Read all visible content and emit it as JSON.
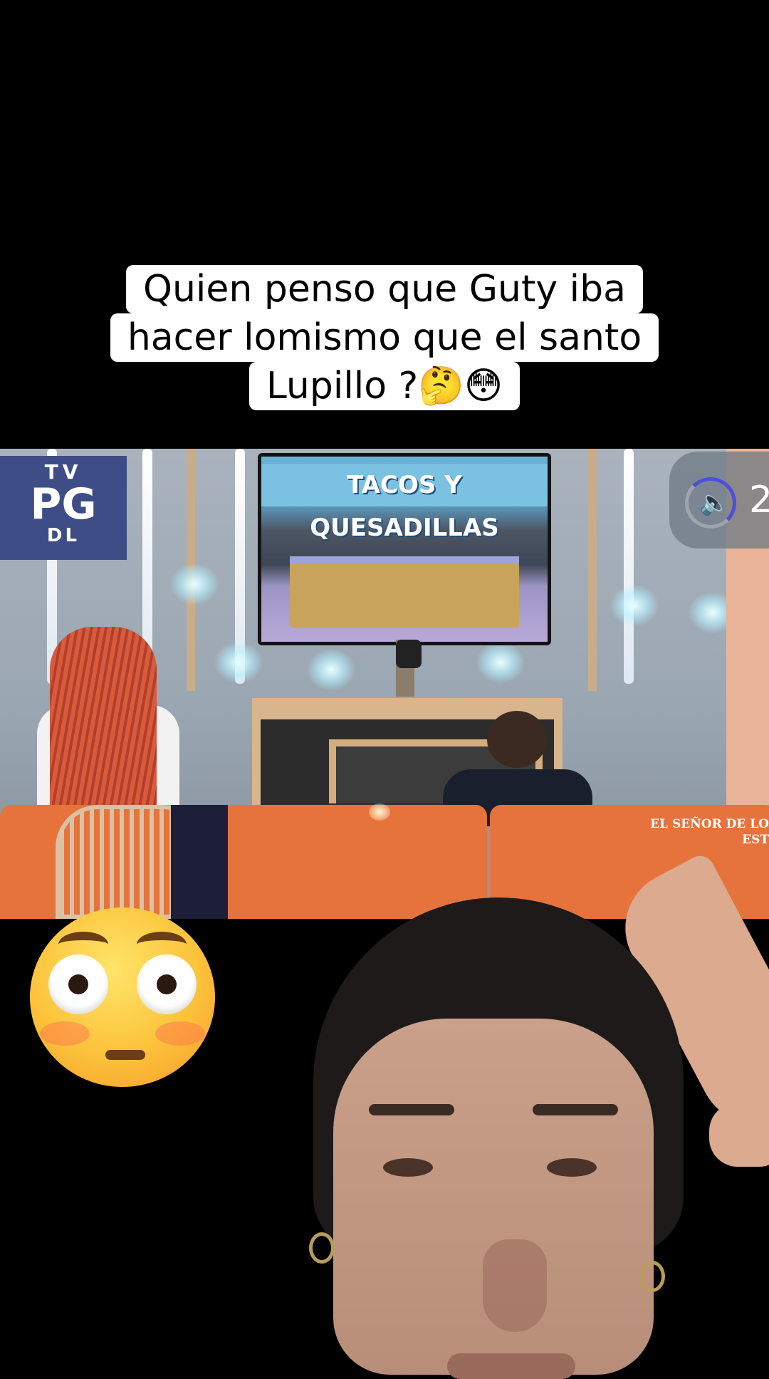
{
  "caption": {
    "line1": "Quien penso que Guty iba",
    "line2": "hacer lomismo que el santo",
    "line3": "Lupillo ?🤔😳"
  },
  "video": {
    "rating": {
      "top": "TV",
      "main": "PG",
      "bottom": "DL"
    },
    "monitor_banner": "TACOS Y QUESADILLAS",
    "volume": {
      "icon": "speaker-icon",
      "value": "2"
    },
    "ticker": {
      "line1": "EL SEÑOR DE LO",
      "line2": "EST"
    }
  },
  "overlay_emoji": "flushed-face",
  "colors": {
    "caption_bg": "#ffffff",
    "sofa": "#e6733c",
    "rating_bg": "#3e4d86",
    "volume_ring": "#4e4ed8"
  }
}
